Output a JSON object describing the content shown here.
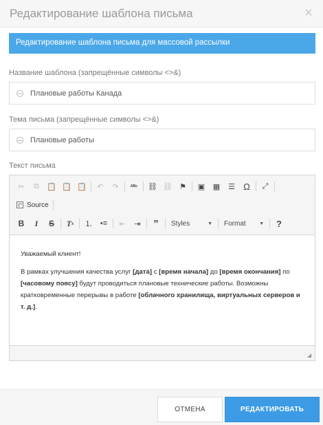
{
  "dialog": {
    "title": "Редактирование шаблона письма",
    "close_icon": "close-icon",
    "banner": "Редактирование шаблона письма для массовой рассылки"
  },
  "form": {
    "name_label": "Название шаблона (запрещённые символы <>&)",
    "name_value": "Плановые работы Канада",
    "subject_label": "Тема письма (запрещённые символы <>&)",
    "subject_value": "Плановые работы",
    "body_label": "Текст письма"
  },
  "editor": {
    "source_label": "Source",
    "styles_label": "Styles",
    "format_label": "Format",
    "help_label": "?",
    "content": {
      "greeting": "Уважаемый клиент!",
      "p_t1": "В рамках улучшения качества услуг ",
      "p_b1": "[дата]",
      "p_t2": " с ",
      "p_b2": "[время начала]",
      "p_t3": " до ",
      "p_b3": "[время окончания]",
      "p_t4": " по ",
      "p_b4": "[часовому поясу]",
      "p_t5": " будут проводиться плановые технические работы. Возможны кратковременные перерывы в работе ",
      "p_b5": "[облачного хранилища, виртуальных серверов и т. д.]",
      "p_t6": "."
    }
  },
  "footer": {
    "cancel_label": "ОТМЕНА",
    "submit_label": "РЕДАКТИРОВАТЬ"
  },
  "colors": {
    "accent": "#4aa7e8",
    "primary_button": "#3d9be5"
  }
}
